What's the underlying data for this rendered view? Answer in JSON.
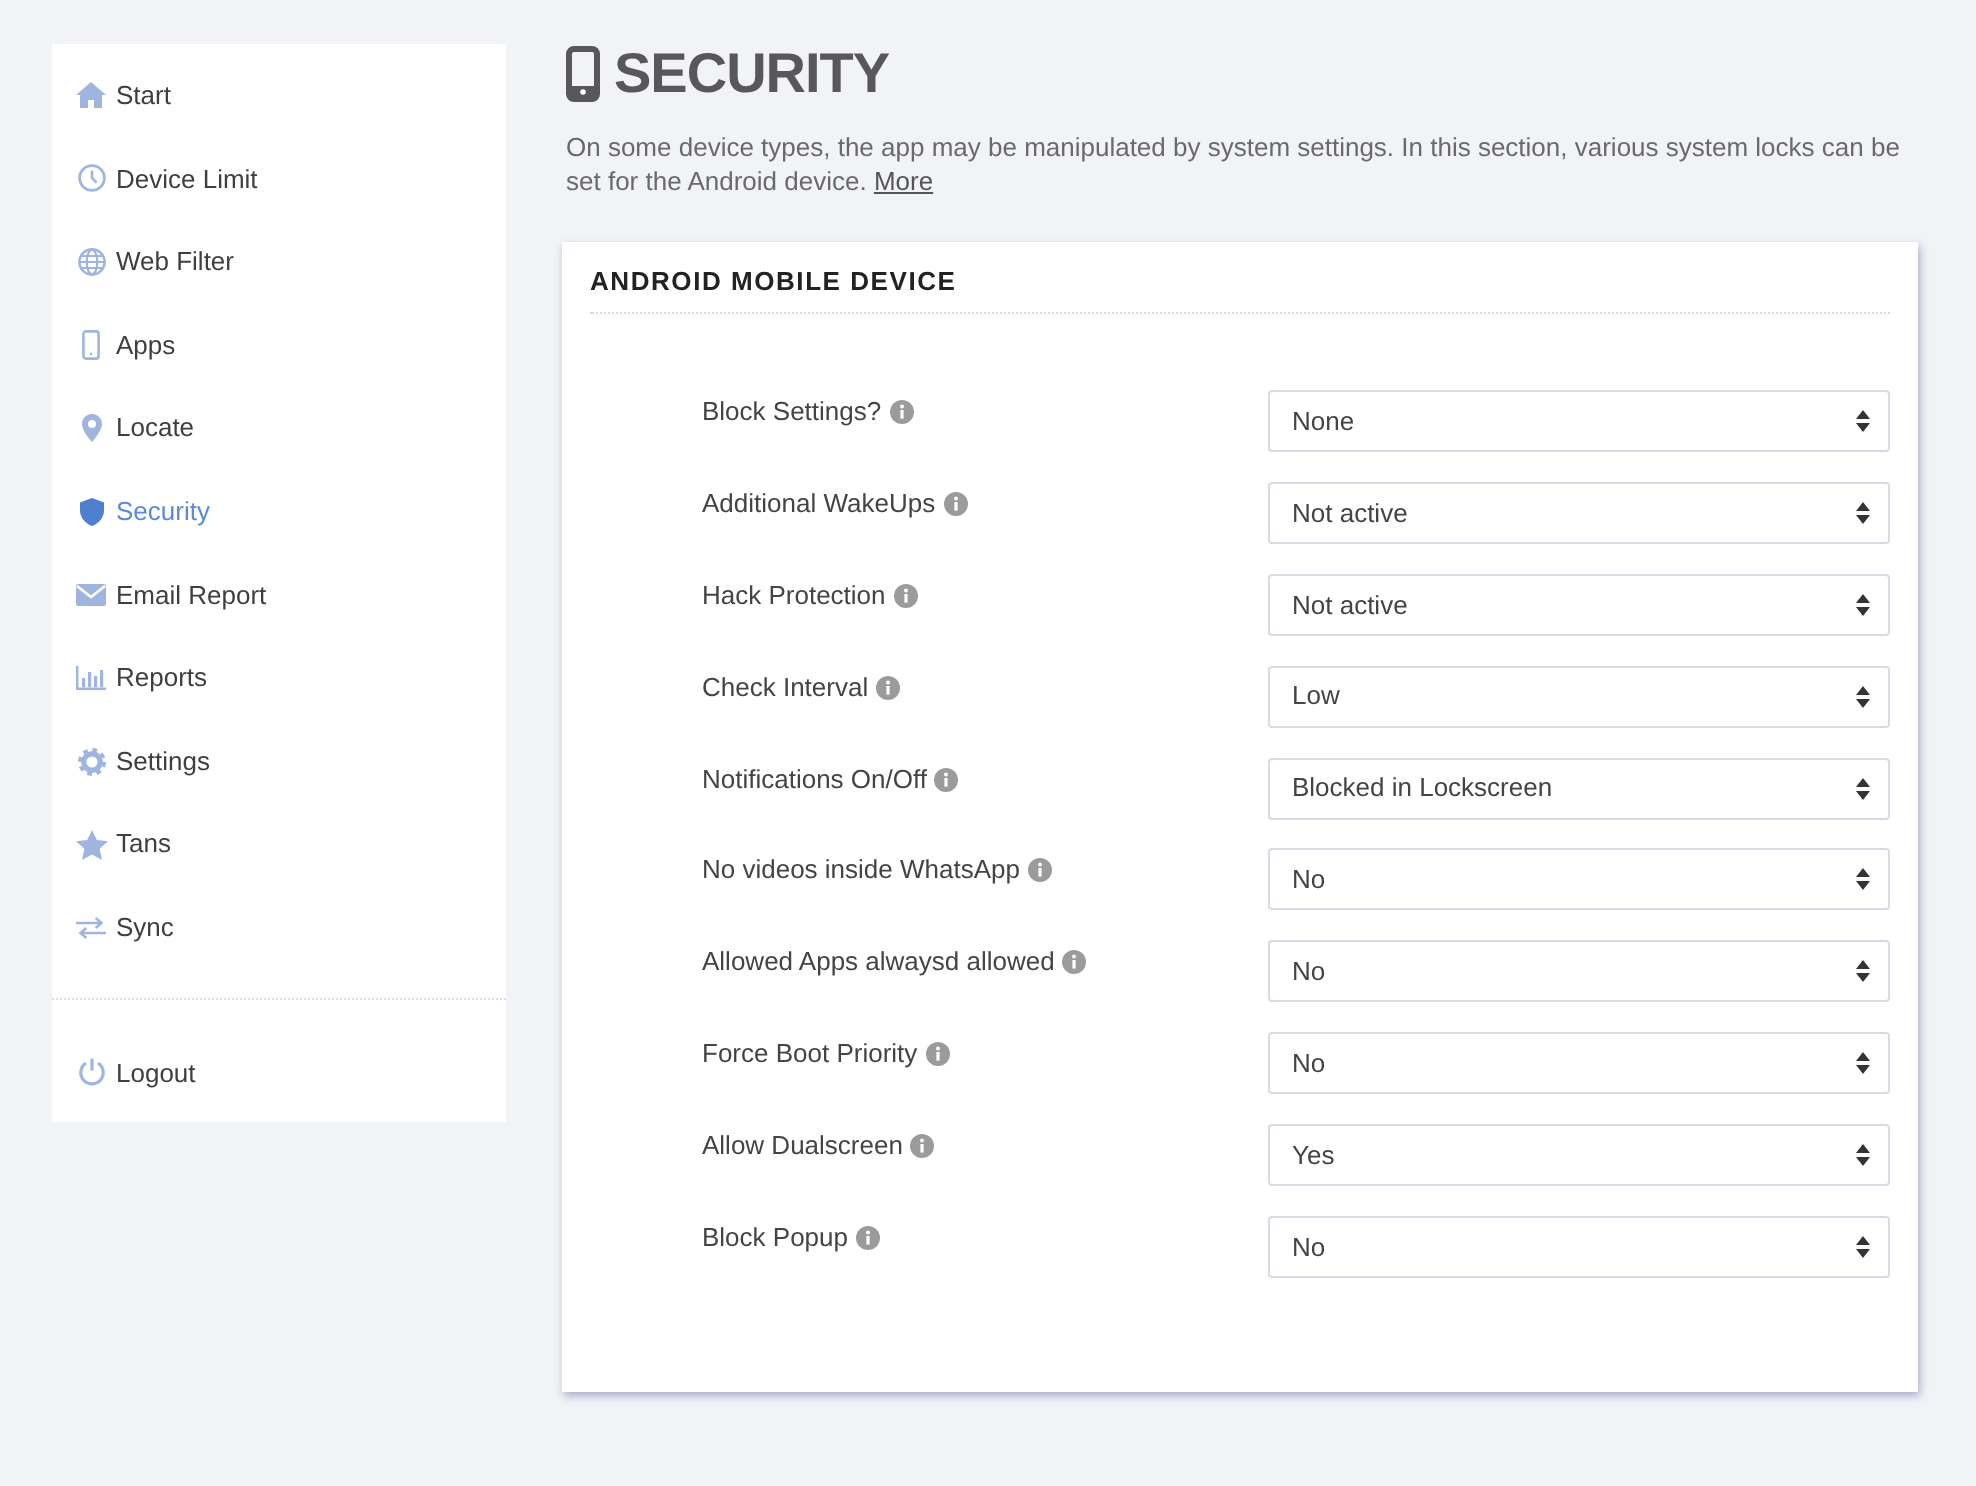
{
  "sidebar": {
    "items": [
      {
        "label": "Start",
        "kind": "home",
        "selected": false
      },
      {
        "label": "Device Limit",
        "kind": "clock",
        "selected": false
      },
      {
        "label": "Web Filter",
        "kind": "globe",
        "selected": false
      },
      {
        "label": "Apps",
        "kind": "phone",
        "selected": false
      },
      {
        "label": "Locate",
        "kind": "pin",
        "selected": false
      },
      {
        "label": "Security",
        "kind": "shield",
        "selected": true
      },
      {
        "label": "Email Report",
        "kind": "envelope",
        "selected": false
      },
      {
        "label": "Reports",
        "kind": "chart",
        "selected": false
      },
      {
        "label": "Settings",
        "kind": "gear",
        "selected": false
      },
      {
        "label": "Tans",
        "kind": "star",
        "selected": false
      },
      {
        "label": "Sync",
        "kind": "sync",
        "selected": false
      }
    ],
    "logout": {
      "label": "Logout"
    }
  },
  "page": {
    "title": "SECURITY",
    "description": "On some device types, the app may be manipulated by system settings. In this section, various system locks can be set for the Android device.",
    "more_link": "More"
  },
  "card": {
    "title": "ANDROID MOBILE DEVICE",
    "settings": [
      {
        "label": "Block Settings?",
        "value": "None"
      },
      {
        "label": "Additional WakeUps",
        "value": "Not active"
      },
      {
        "label": "Hack Protection",
        "value": "Not active"
      },
      {
        "label": "Check Interval",
        "value": "Low"
      },
      {
        "label": "Notifications On/Off",
        "value": "Blocked in Lockscreen"
      },
      {
        "label": "No videos inside WhatsApp",
        "value": "No"
      },
      {
        "label": "Allowed Apps alwaysd allowed",
        "value": "No"
      },
      {
        "label": "Force Boot Priority",
        "value": "No"
      },
      {
        "label": "Allow Dualscreen",
        "value": "Yes"
      },
      {
        "label": "Block Popup",
        "value": "No"
      }
    ]
  }
}
